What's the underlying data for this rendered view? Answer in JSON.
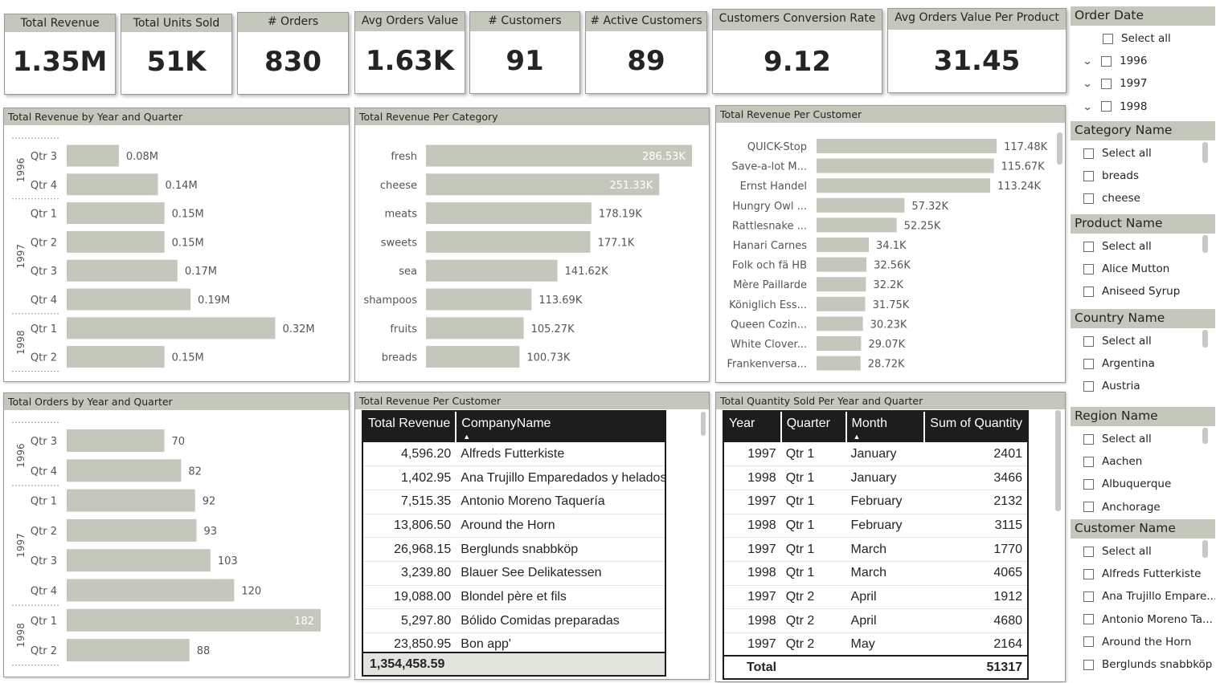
{
  "kpis": [
    {
      "label": "Total Revenue",
      "value": "1.35M"
    },
    {
      "label": "Total Units Sold",
      "value": "51K"
    },
    {
      "label": "# Orders",
      "value": "830"
    },
    {
      "label": "Avg Orders Value",
      "value": "1.63K"
    },
    {
      "label": "# Customers",
      "value": "91"
    },
    {
      "label": "# Active Customers",
      "value": "89"
    },
    {
      "label": "Customers Conversion Rate",
      "value": "9.12"
    },
    {
      "label": "Avg Orders Value Per Product",
      "value": "31.45"
    }
  ],
  "chart_data": [
    {
      "title": "Total Revenue by Year and Quarter",
      "type": "bar",
      "orientation": "horizontal",
      "groups": [
        {
          "name": "1996",
          "categories": [
            "Qtr 3",
            "Qtr 4"
          ]
        },
        {
          "name": "1997",
          "categories": [
            "Qtr 1",
            "Qtr 2",
            "Qtr 3",
            "Qtr 4"
          ]
        },
        {
          "name": "1998",
          "categories": [
            "Qtr 1",
            "Qtr 2"
          ]
        }
      ],
      "values": [
        0.08,
        0.14,
        0.15,
        0.15,
        0.17,
        0.19,
        0.32,
        0.15
      ],
      "labels": [
        "0.08M",
        "0.14M",
        "0.15M",
        "0.15M",
        "0.17M",
        "0.19M",
        "0.32M",
        "0.15M"
      ],
      "xlim": [
        0,
        0.37
      ],
      "bar_color": "#c4c8bc"
    },
    {
      "title": "Total Revenue Per Category",
      "type": "bar",
      "orientation": "horizontal",
      "categories": [
        "fresh",
        "cheese",
        "meats",
        "sweets",
        "sea",
        "shampoos",
        "fruits",
        "breads"
      ],
      "values": [
        286.53,
        251.33,
        178.19,
        177.1,
        141.62,
        113.69,
        105.27,
        100.73
      ],
      "labels": [
        "286.53K",
        "251.33K",
        "178.19K",
        "177.1K",
        "141.62K",
        "113.69K",
        "105.27K",
        "100.73K"
      ],
      "xlim": [
        0,
        290
      ],
      "bar_color": "#c4c8bc"
    },
    {
      "title": "Total Revenue Per Customer",
      "type": "bar",
      "orientation": "horizontal",
      "categories": [
        "QUICK-Stop",
        "Save-a-lot M...",
        "Ernst Handel",
        "Hungry Owl ...",
        "Rattlesnake ...",
        "Hanari Carnes",
        "Folk och fä HB",
        "Mère Paillarde",
        "Königlich Ess...",
        "Queen Cozin...",
        "White Clover...",
        "Frankenversa..."
      ],
      "values": [
        117.48,
        115.67,
        113.24,
        57.32,
        52.25,
        34.1,
        32.56,
        32.2,
        31.75,
        30.23,
        29.07,
        28.72
      ],
      "labels": [
        "117.48K",
        "115.67K",
        "113.24K",
        "57.32K",
        "52.25K",
        "34.1K",
        "32.56K",
        "32.2K",
        "31.75K",
        "30.23K",
        "29.07K",
        "28.72K"
      ],
      "xlim": [
        0,
        130
      ],
      "bar_color": "#c4c8bc"
    },
    {
      "title": "Total Orders by Year and Quarter",
      "type": "bar",
      "orientation": "horizontal",
      "groups": [
        {
          "name": "1996",
          "categories": [
            "Qtr 3",
            "Qtr 4"
          ]
        },
        {
          "name": "1997",
          "categories": [
            "Qtr 1",
            "Qtr 2",
            "Qtr 3",
            "Qtr 4"
          ]
        },
        {
          "name": "1998",
          "categories": [
            "Qtr 1",
            "Qtr 2"
          ]
        }
      ],
      "values": [
        70,
        82,
        92,
        93,
        103,
        120,
        182,
        88
      ],
      "labels": [
        "70",
        "82",
        "92",
        "93",
        "103",
        "120",
        "182",
        "88"
      ],
      "xlim": [
        0,
        182
      ],
      "bar_color": "#c4c8bc"
    }
  ],
  "revenue_table": {
    "title": "Total Revenue Per Customer",
    "columns": [
      "Total Revenue",
      "CompanyName"
    ],
    "rows": [
      [
        "4,596.20",
        "Alfreds Futterkiste"
      ],
      [
        "1,402.95",
        "Ana Trujillo Emparedados y helados"
      ],
      [
        "7,515.35",
        "Antonio Moreno Taquería"
      ],
      [
        "13,806.50",
        "Around the Horn"
      ],
      [
        "26,968.15",
        "Berglunds snabbköp"
      ],
      [
        "3,239.80",
        "Blauer See Delikatessen"
      ],
      [
        "19,088.00",
        "Blondel père et fils"
      ],
      [
        "5,297.80",
        "Bólido Comidas preparadas"
      ],
      [
        "23,850.95",
        "Bon app'"
      ]
    ],
    "total": "1,354,458.59"
  },
  "quantity_table": {
    "title": "Total Quantity Sold Per Year and Quarter",
    "columns": [
      "Year",
      "Quarter",
      "Month",
      "Sum of Quantity"
    ],
    "rows": [
      [
        "1997",
        "Qtr 1",
        "January",
        "2401"
      ],
      [
        "1998",
        "Qtr 1",
        "January",
        "3466"
      ],
      [
        "1997",
        "Qtr 1",
        "February",
        "2132"
      ],
      [
        "1998",
        "Qtr 1",
        "February",
        "3115"
      ],
      [
        "1997",
        "Qtr 1",
        "March",
        "1770"
      ],
      [
        "1998",
        "Qtr 1",
        "March",
        "4065"
      ],
      [
        "1997",
        "Qtr 2",
        "April",
        "1912"
      ],
      [
        "1998",
        "Qtr 2",
        "April",
        "4680"
      ],
      [
        "1997",
        "Qtr 2",
        "May",
        "2164"
      ]
    ],
    "total_label": "Total",
    "total": "51317"
  },
  "slicers": [
    {
      "title": "Order Date",
      "items": [
        "Select all",
        "1996",
        "1997",
        "1998"
      ],
      "expandable": [
        false,
        true,
        true,
        true
      ]
    },
    {
      "title": "Category Name",
      "items": [
        "Select all",
        "breads",
        "cheese"
      ]
    },
    {
      "title": "Product Name",
      "items": [
        "Select all",
        "Alice Mutton",
        "Aniseed Syrup"
      ]
    },
    {
      "title": "Country Name",
      "items": [
        "Select all",
        "Argentina",
        "Austria"
      ]
    },
    {
      "title": "Region Name",
      "items": [
        "Select all",
        "Aachen",
        "Albuquerque",
        "Anchorage"
      ]
    },
    {
      "title": "Customer Name",
      "items": [
        "Select all",
        "Alfreds Futterkiste",
        "Ana Trujillo Empare...",
        "Antonio Moreno Ta...",
        "Around the Horn",
        "Berglunds snabbköp"
      ]
    }
  ],
  "colors": {
    "accent": "#c4c8bc",
    "header_bg": "#1d1d1d",
    "text": "#252423"
  }
}
